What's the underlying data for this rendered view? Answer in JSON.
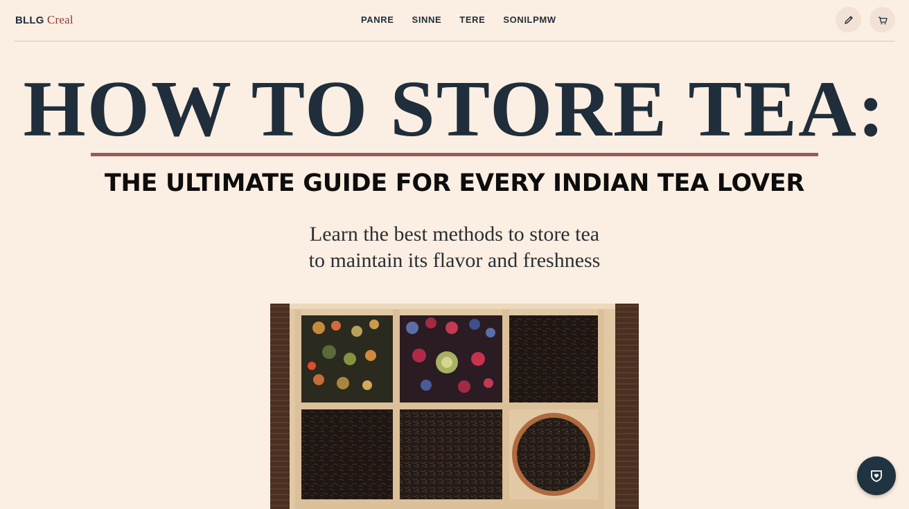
{
  "header": {
    "logo_part1": "BLLG",
    "logo_part2": "Creal",
    "nav": [
      "PANRE",
      "SINNE",
      "TERE",
      "SONILPMW"
    ]
  },
  "hero": {
    "title": "HOW TO STORE TEA:",
    "subtitle": "THE ULTIMATE GUIDE FOR EVERY INDIAN TEA LOVER",
    "description_line1": "Learn the best methods to store tea",
    "description_line2": "to maintain its flavor and freshness"
  },
  "image": {
    "subject": "wooden tea storage box with six compartments of loose-leaf tea"
  },
  "icons": {
    "edit": "pen-icon",
    "cart": "cart-icon",
    "chat": "shield-heart-icon"
  },
  "colors": {
    "background": "#fbeee2",
    "text_dark": "#1f2e3a",
    "accent_rule": "#9a5a55",
    "logo_accent": "#8a3b3b",
    "chat_button": "#1f3440"
  }
}
